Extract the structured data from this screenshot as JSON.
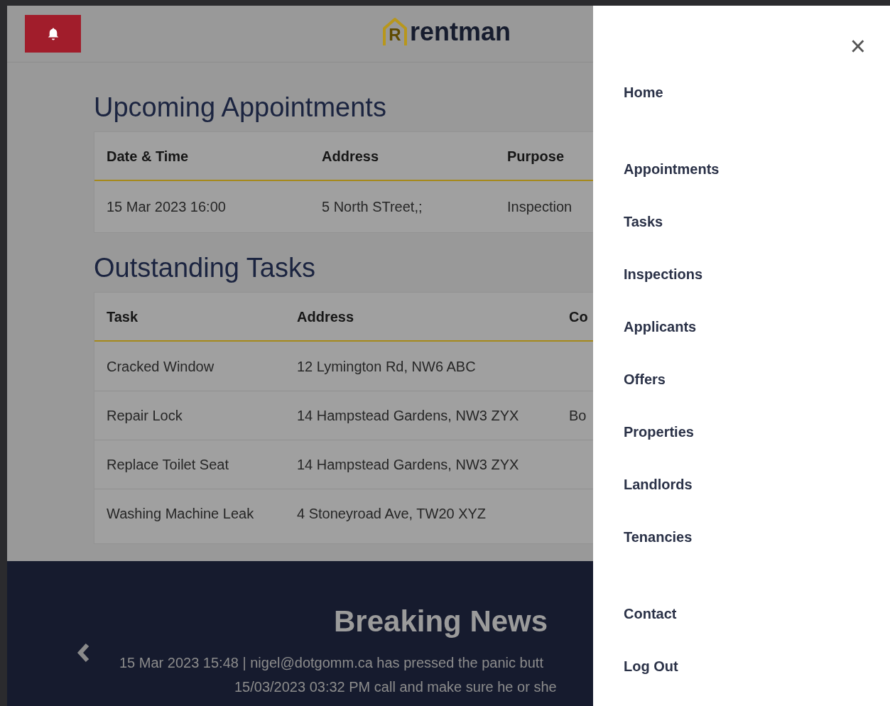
{
  "header": {
    "alert_button": {
      "kind": "bell"
    },
    "logo": {
      "mark": "R",
      "word": "rentman"
    }
  },
  "appointments": {
    "title": "Upcoming Appointments",
    "columns": [
      "Date & Time",
      "Address",
      "Purpose"
    ],
    "rows": [
      [
        "15 Mar 2023 16:00",
        "5 North STreet,;",
        "Inspection"
      ]
    ]
  },
  "tasks": {
    "title": "Outstanding Tasks",
    "columns": [
      "Task",
      "Address",
      "Co"
    ],
    "rows": [
      [
        "Cracked Window",
        "12 Lymington Rd, NW6 ABC",
        ""
      ],
      [
        "Repair Lock",
        "14 Hampstead Gardens, NW3 ZYX",
        "Bo"
      ],
      [
        "Replace Toilet Seat",
        "14 Hampstead Gardens, NW3 ZYX",
        ""
      ],
      [
        "Washing Machine Leak",
        "4 Stoneyroad Ave, TW20 XYZ",
        ""
      ]
    ]
  },
  "news": {
    "title": "Breaking News",
    "lines": [
      "15 Mar 2023 15:48 | nigel@dotgomm.ca has pressed the panic butt",
      "15/03/2023 03:32 PM call and make sure he or she"
    ]
  },
  "menu": {
    "close": "×",
    "groups": [
      [
        "Home"
      ],
      [
        "Appointments",
        "Tasks",
        "Inspections",
        "Applicants",
        "Offers",
        "Properties",
        "Landlords",
        "Tenancies"
      ],
      [
        "Contact",
        "Log Out"
      ]
    ]
  }
}
